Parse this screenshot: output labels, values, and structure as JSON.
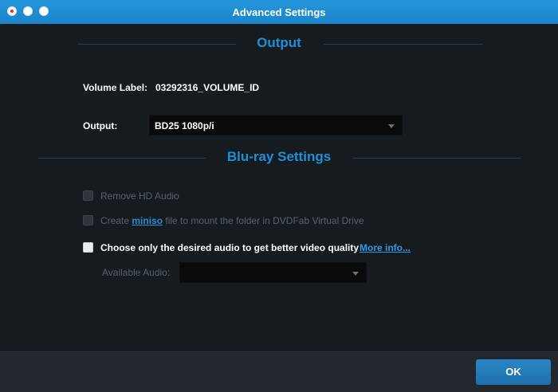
{
  "window": {
    "title": "Advanced Settings"
  },
  "output_section": {
    "title": "Output",
    "volume_label": "Volume Label:",
    "volume_value": "03292316_VOLUME_ID",
    "output_label": "Output:",
    "output_value": "BD25 1080p/i"
  },
  "bluray_section": {
    "title": "Blu-ray Settings",
    "remove_hd_audio": {
      "label": "Remove HD Audio",
      "checked": false,
      "enabled": false
    },
    "create_miniso": {
      "prefix": "Create ",
      "link": "miniso",
      "suffix": " file to mount the folder in DVDFab Virtual Drive",
      "checked": false,
      "enabled": false
    },
    "choose_audio": {
      "label": "Choose only the desired audio to get better video quality",
      "checked": false,
      "enabled": true
    },
    "more_info": "More info...",
    "available_audio_label": "Available Audio:",
    "available_audio_value": ""
  },
  "footer": {
    "ok_label": "OK"
  },
  "colors": {
    "titlebar": "#1d8ad0",
    "accent": "#1f8fd8",
    "background": "#161b20",
    "footer": "#22282e"
  }
}
